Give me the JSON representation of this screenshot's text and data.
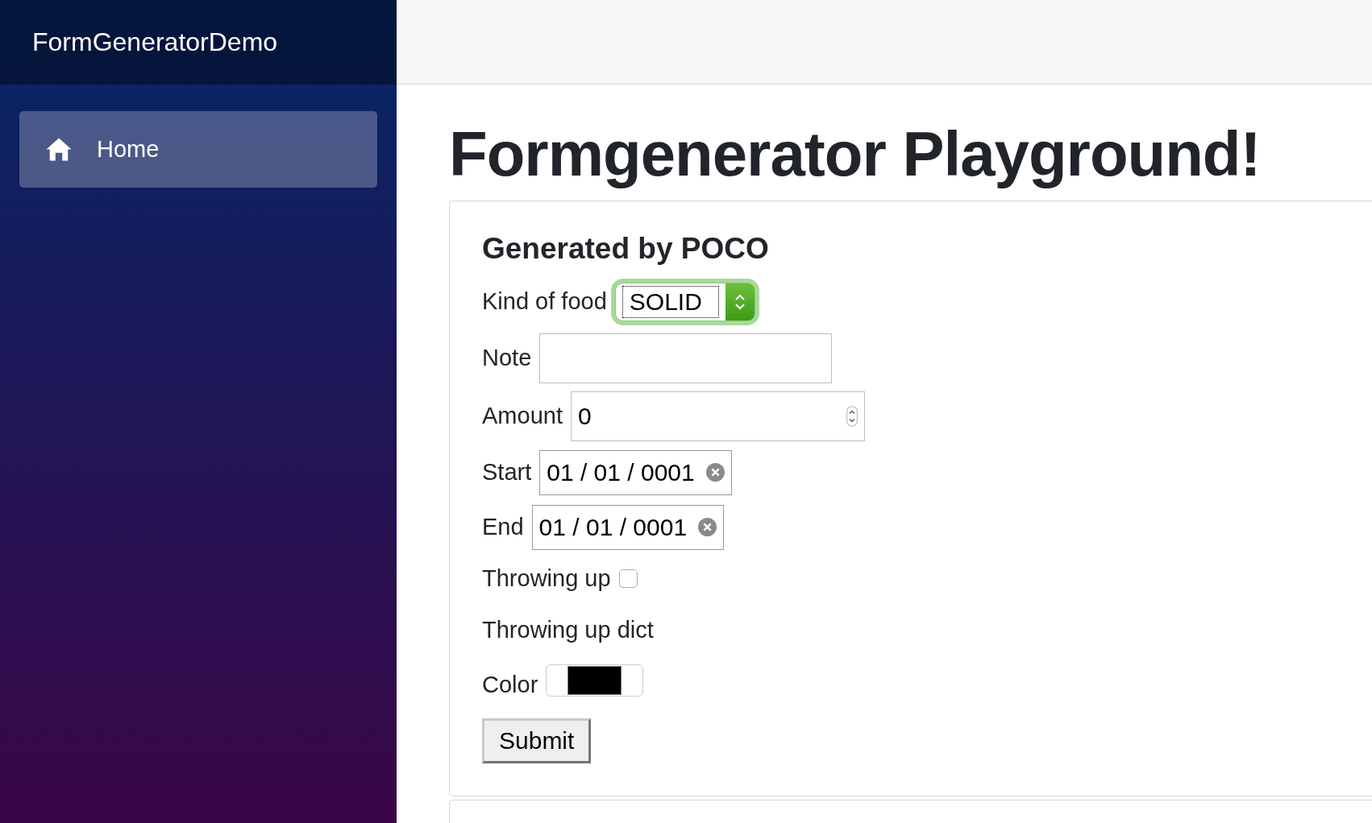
{
  "brand": "FormGeneratorDemo",
  "nav": [
    {
      "label": "Home",
      "selected": true
    }
  ],
  "page_title": "Formgenerator Playground!",
  "form": {
    "heading": "Generated by POCO",
    "fields": [
      {
        "kind": "select",
        "label": "Kind of food",
        "value": "SOLID",
        "focused": true
      },
      {
        "kind": "text",
        "label": "Note"
      },
      {
        "kind": "number",
        "label": "Amount",
        "value": "0"
      },
      {
        "kind": "date",
        "label": "Start",
        "value": "01 / 01 / 0001"
      },
      {
        "kind": "date",
        "label": "End",
        "value": "01 / 01 / 0001"
      },
      {
        "kind": "checkbox",
        "label": "Throwing up",
        "checked": false
      },
      {
        "kind": "heading",
        "label": "Throwing up dict"
      },
      {
        "kind": "color",
        "label": "Color",
        "color": "#000000"
      }
    ],
    "submit": "Submit"
  }
}
